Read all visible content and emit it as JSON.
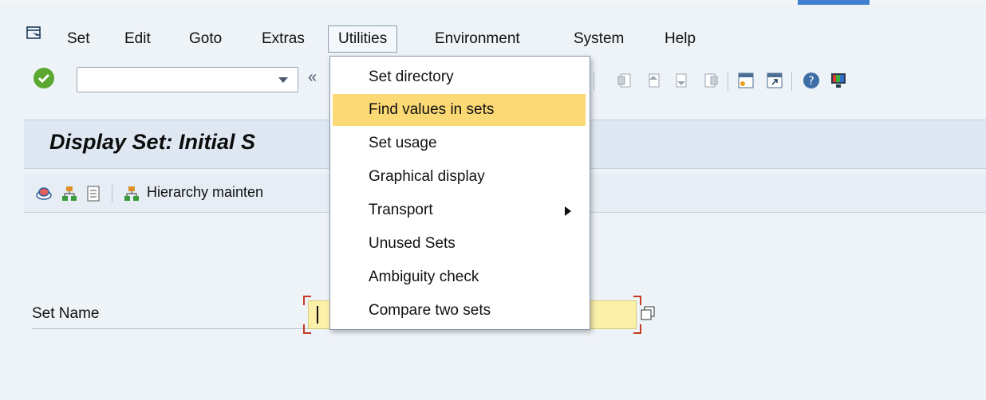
{
  "menubar": {
    "items": [
      "Set",
      "Edit",
      "Goto",
      "Extras",
      "Utilities",
      "Environment",
      "System",
      "Help"
    ],
    "active": "Utilities"
  },
  "toolbar": {
    "command_value": "",
    "icons": [
      "confirm-check-icon",
      "save-icon",
      "back-icon",
      "exit-icon",
      "cancel-icon",
      "print-icon",
      "find-icon",
      "find-next-icon",
      "first-page-icon",
      "previous-page-icon",
      "next-page-icon",
      "last-page-icon",
      "new-session-icon",
      "create-shortcut-icon",
      "help-icon",
      "customize-layout-icon"
    ]
  },
  "page": {
    "title": "Display Set: Initial S"
  },
  "app_toolbar": {
    "hierarchy_label": "Hierarchy mainten"
  },
  "form": {
    "set_name_label": "Set Name",
    "set_name_value": ""
  },
  "utilities_menu": {
    "items": [
      {
        "label": "Set directory",
        "highlighted": false,
        "submenu": false
      },
      {
        "label": "Find values in sets",
        "highlighted": true,
        "submenu": false
      },
      {
        "label": "Set usage",
        "highlighted": false,
        "submenu": false
      },
      {
        "label": "Graphical display",
        "highlighted": false,
        "submenu": false
      },
      {
        "label": "Transport",
        "highlighted": false,
        "submenu": true
      },
      {
        "label": "Unused Sets",
        "highlighted": false,
        "submenu": false
      },
      {
        "label": "Ambiguity check",
        "highlighted": false,
        "submenu": false
      },
      {
        "label": "Compare two sets",
        "highlighted": false,
        "submenu": false
      }
    ]
  },
  "colors": {
    "highlight": "#fbd975",
    "input_bg": "#fbf0a8",
    "accent": "#3f7fcf",
    "ok_green": "#5aa832",
    "required_bracket": "#c43a22"
  }
}
